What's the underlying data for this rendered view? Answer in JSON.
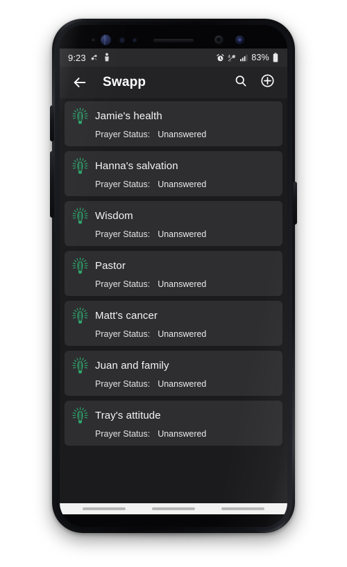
{
  "status_bar": {
    "time": "9:23",
    "battery_percent": "83%",
    "left_icons": [
      "mute-vibrate-icon",
      "app-notification-icon"
    ],
    "right_icons": [
      "alarm-clock-icon",
      "data-saver-icon",
      "signal-bars-icon",
      "battery-icon"
    ]
  },
  "app_bar": {
    "back_label": "Back",
    "title": "Swapp",
    "search_label": "Search",
    "add_label": "Add prayer"
  },
  "list": {
    "status_label": "Prayer Status:",
    "items": [
      {
        "title": "Jamie's health",
        "status": "Unanswered"
      },
      {
        "title": "Hanna's salvation",
        "status": "Unanswered"
      },
      {
        "title": "Wisdom",
        "status": "Unanswered"
      },
      {
        "title": "Pastor",
        "status": "Unanswered"
      },
      {
        "title": "Matt's cancer",
        "status": "Unanswered"
      },
      {
        "title": "Juan and family",
        "status": "Unanswered"
      },
      {
        "title": "Tray's attitude",
        "status": "Unanswered"
      }
    ]
  },
  "colors": {
    "screen_background": "#1b1b1d",
    "card_background": "#2e2e31",
    "app_bar_background": "#232325",
    "status_bar_background": "#2a2a2c",
    "accent_green": "#2faa6e",
    "primary_text": "#f4f4f6",
    "nav_bar_background": "#f2f2f2"
  }
}
